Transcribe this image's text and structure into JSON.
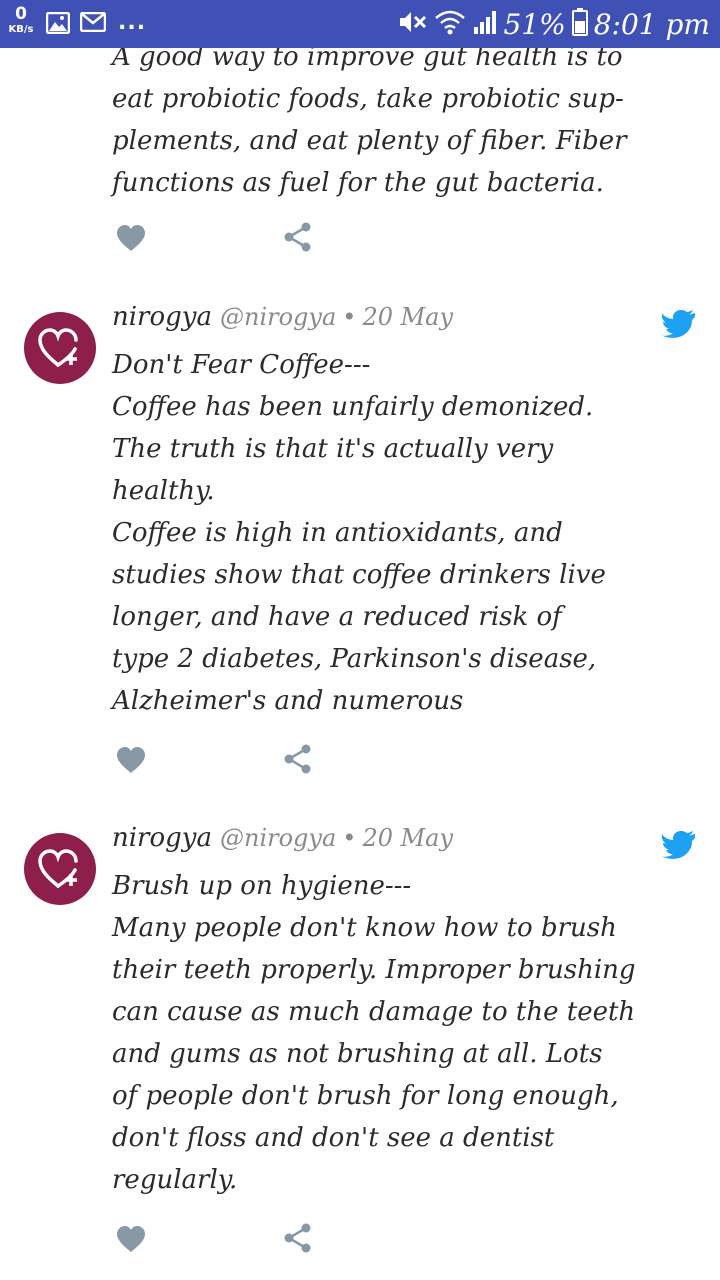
{
  "status_bar": {
    "network_speed_value": "0",
    "network_speed_unit": "KB/s",
    "overflow": "...",
    "battery": "51%",
    "time": "8:01 pm",
    "icons": [
      "gallery-icon",
      "gmail-icon",
      "mute-icon",
      "wifi-icon",
      "signal-icon",
      "battery-icon"
    ],
    "background": "#3f51b5"
  },
  "previous_tweet": {
    "text": "A good way to improve gut health is to\neat probiotic foods, take probiotic sup-\nplements, and eat plenty of fiber. Fiber\nfunctions as fuel for the gut bacteria."
  },
  "tweets": [
    {
      "name": "nirogya",
      "handle": "@nirogya",
      "separator": "•",
      "date": "20 May",
      "text": "Don't Fear Coffee---\nCoffee has been unfairly demonized.\nThe truth is that it's actually very\nhealthy.\nCoffee is high in antioxidants, and\nstudies show that coffee drinkers live\nlonger, and have a reduced risk of\ntype 2 diabetes, Parkinson's disease,\nAlzheimer's and numerous"
    },
    {
      "name": "nirogya",
      "handle": "@nirogya",
      "separator": "•",
      "date": "20 May",
      "text": "Brush up on hygiene---\nMany people don't know how to brush\ntheir teeth properly. Improper brushing\ncan cause as much damage to the teeth\nand gums as not brushing at all. Lots\nof people don't brush for long enough,\ndon't floss and don't see a dentist\nregularly."
    }
  ],
  "colors": {
    "avatar": "#8e1f4d",
    "twitter_blue": "#1da1f2",
    "action_gray": "#8899a6"
  }
}
